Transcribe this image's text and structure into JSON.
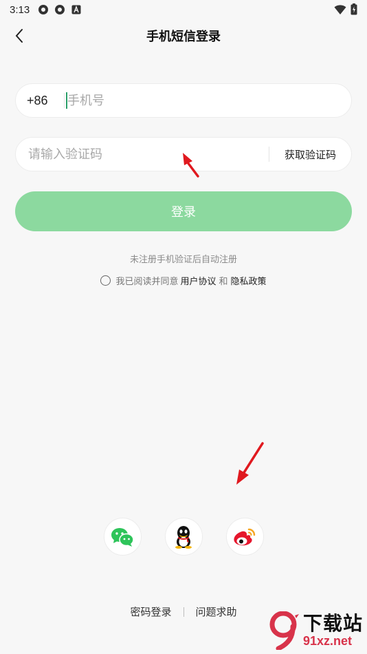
{
  "status_bar": {
    "time": "3:13"
  },
  "header": {
    "title": "手机短信登录"
  },
  "phone_field": {
    "country_code": "+86",
    "placeholder": "手机号",
    "value": ""
  },
  "code_field": {
    "placeholder": "请输入验证码",
    "value": "",
    "get_code_label": "获取验证码"
  },
  "login_button": {
    "label": "登录"
  },
  "hint": {
    "text": "未注册手机验证后自动注册"
  },
  "agreement": {
    "prefix": "我已阅读并同意",
    "user_agreement": "用户协议",
    "and": "和",
    "privacy_policy": "隐私政策"
  },
  "social": [
    {
      "name": "wechat",
      "icon": "wechat-icon",
      "color": "#2ec45a"
    },
    {
      "name": "qq",
      "icon": "qq-icon",
      "color": "#111111"
    },
    {
      "name": "weibo",
      "icon": "weibo-icon",
      "color": "#e6162d"
    }
  ],
  "bottom_links": {
    "password_login": "密码登录",
    "help": "问题求助"
  },
  "watermark": {
    "top": "下载站",
    "bottom": "91xz.net",
    "logo": "9"
  },
  "colors": {
    "accent_green": "#8cd99f",
    "cursor": "#2aa06a",
    "arrow": "#e0191f"
  }
}
